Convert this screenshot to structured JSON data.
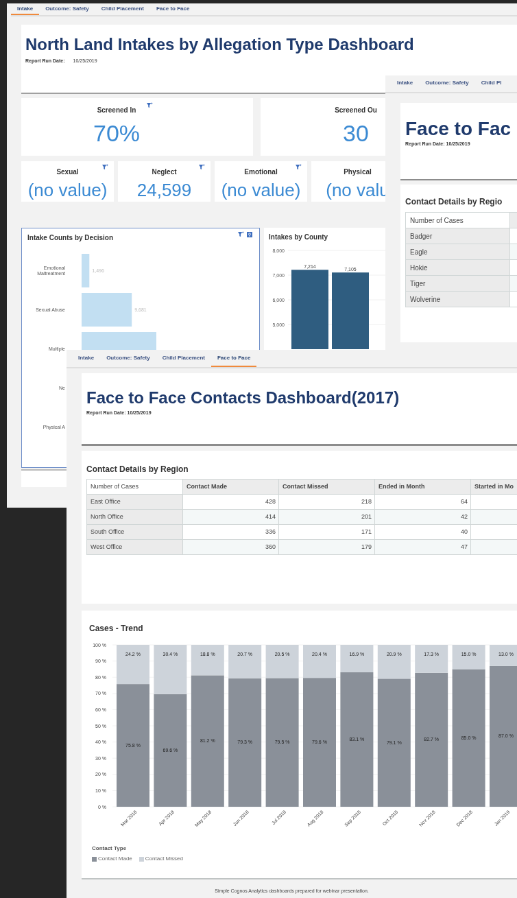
{
  "intake_dashboard": {
    "tabs": [
      {
        "label": "Intake",
        "selected": true
      },
      {
        "label": "Outcome: Safety",
        "selected": false
      },
      {
        "label": "Child Placement",
        "selected": false
      },
      {
        "label": "Face to Face",
        "selected": false
      }
    ],
    "title": "North Land Intakes by Allegation Type Dashboard",
    "run_date_label": "Report Run Date:",
    "run_date": "10/25/2019",
    "kpis_top": [
      {
        "label": "Screened In",
        "value": "70%",
        "filter": true
      },
      {
        "label": "Screened Ou",
        "value": "30",
        "filter": false
      }
    ],
    "kpis_allegation": [
      {
        "label": "Sexual",
        "value": "(no value)",
        "filter": true
      },
      {
        "label": "Neglect",
        "value": "24,599",
        "filter": true
      },
      {
        "label": "Emotional",
        "value": "(no value)",
        "filter": true
      },
      {
        "label": "Physical",
        "value": "(no valu",
        "filter": false
      }
    ],
    "decision_chart": {
      "chart_data": {
        "type": "bar",
        "orientation": "horizontal",
        "title": "Intake Counts by Decision",
        "categories": [
          "Emotional Maltreatment",
          "Sexual Abuse",
          "Multiple",
          "Ne",
          "Physical A"
        ],
        "values": [
          1496,
          9681,
          14420,
          null,
          null
        ],
        "value_labels": [
          "1,496",
          "9,681",
          null,
          null,
          null
        ]
      }
    },
    "county_chart": {
      "chart_data": {
        "type": "bar",
        "grid": true,
        "title": "Intakes by County",
        "values": [
          7214,
          7105
        ],
        "value_labels": [
          "7,214",
          "7,105"
        ],
        "ylim": [
          4000,
          8000
        ],
        "yticks": [
          {
            "value": 5000,
            "label": "5,000"
          },
          {
            "value": 6000,
            "label": "6,000"
          },
          {
            "value": 7000,
            "label": "7,000"
          },
          {
            "value": 8000,
            "label": "8,000"
          }
        ]
      }
    }
  },
  "regions_dashboard": {
    "tabs": [
      {
        "label": "Intake",
        "selected": false
      },
      {
        "label": "Outcome: Safety",
        "selected": false
      },
      {
        "label": "Child Pl",
        "selected": false
      }
    ],
    "title": "Face to Fac",
    "run_date": "Report Run Date: 10/25/2019",
    "table_title": "Contact Details by Regio",
    "table": {
      "columns": [
        "Number of Cases"
      ],
      "rows": [
        "Badger",
        "Eagle",
        "Hokie",
        "Tiger",
        "Wolverine"
      ]
    }
  },
  "contacts_dashboard": {
    "tabs": [
      {
        "label": "Intake",
        "selected": false
      },
      {
        "label": "Outcome: Safety",
        "selected": false
      },
      {
        "label": "Child Placement",
        "selected": false
      },
      {
        "label": "Face to Face",
        "selected": true
      }
    ],
    "title": "Face to Face Contacts Dashboard(2017)",
    "run_date": "Report Run Date: 10/25/2019",
    "table_title": "Contact Details by Region",
    "table": {
      "columns": [
        "Number of Cases",
        "Contact Made",
        "Contact Missed",
        "Ended in Month",
        "Started in Mo"
      ],
      "rows": [
        [
          "East Office",
          "428",
          "218",
          "64"
        ],
        [
          "North Office",
          "414",
          "201",
          "42"
        ],
        [
          "South Office",
          "336",
          "171",
          "40"
        ],
        [
          "West Office",
          "360",
          "179",
          "47"
        ]
      ]
    },
    "trend_chart": {
      "chart_data": {
        "type": "bar",
        "stacked": true,
        "grid": true,
        "title": "Cases - Trend",
        "legend": {
          "title": "Contact Type"
        },
        "categories": [
          "Mar 2018",
          "Apr 2018",
          "May 2018",
          "Jun 2018",
          "Jul 2018",
          "Aug 2018",
          "Sep 2018",
          "Oct 2018",
          "Nov 2018",
          "Dec 2018",
          "Jan 2019"
        ],
        "series": [
          {
            "name": "Contact Made",
            "color": "#8a9099",
            "values": [
              75.8,
              69.6,
              81.2,
              79.3,
              79.5,
              79.6,
              83.1,
              79.1,
              82.7,
              85.0,
              87.0
            ]
          },
          {
            "name": "Contact Missed",
            "color": "#cdd3da",
            "values": [
              24.2,
              30.4,
              18.8,
              20.7,
              20.5,
              20.4,
              16.9,
              20.9,
              17.3,
              15.0,
              13.0
            ]
          }
        ],
        "value_labels": [
          [
            "75.8 %",
            "69.6 %",
            "81.2 %",
            "79.3 %",
            "79.5 %",
            "79.6 %",
            "83.1 %",
            "79.1 %",
            "82.7 %",
            "85.0 %",
            "87.0 %"
          ],
          [
            "24.2 %",
            "30.4 %",
            "18.8 %",
            "20.7 %",
            "20.5 %",
            "20.4 %",
            "16.9 %",
            "20.9 %",
            "17.3 %",
            "15.0 %",
            "13.0 %"
          ]
        ],
        "ylim": [
          0,
          100
        ],
        "yticks": [
          {
            "value": 0,
            "label": "0 %"
          },
          {
            "value": 10,
            "label": "10 %"
          },
          {
            "value": 20,
            "label": "20 %"
          },
          {
            "value": 30,
            "label": "30 %"
          },
          {
            "value": 40,
            "label": "40 %"
          },
          {
            "value": 50,
            "label": "50 %"
          },
          {
            "value": 60,
            "label": "60 %"
          },
          {
            "value": 70,
            "label": "70 %"
          },
          {
            "value": 80,
            "label": "80 %"
          },
          {
            "value": 90,
            "label": "90 %"
          },
          {
            "value": 100,
            "label": "100 %"
          }
        ]
      }
    },
    "footer": "Simple Cognos Analytics dashboards prepared for webinar presentation."
  }
}
